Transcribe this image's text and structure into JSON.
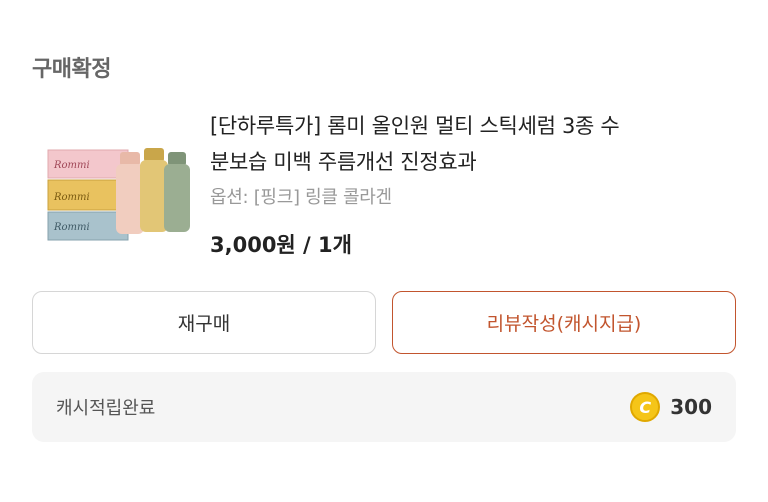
{
  "header": {
    "status_title": "구매확정"
  },
  "product": {
    "title_line1": "[단하루특가] 롬미 올인원 멀티 스틱세럼 3종 수",
    "title_line2": "분보습 미백 주름개선 진정효과",
    "option": "옵션: [핑크] 링클 콜라겐",
    "price": "3,000원 / 1개",
    "image_brand": "Rommi"
  },
  "actions": {
    "rebuy_label": "재구매",
    "review_label": "리뷰작성(캐시지급)"
  },
  "cash": {
    "label": "캐시적립완료",
    "coin_symbol": "C",
    "amount": "300"
  },
  "colors": {
    "accent": "#c2552e",
    "coin": "#f5c518"
  }
}
